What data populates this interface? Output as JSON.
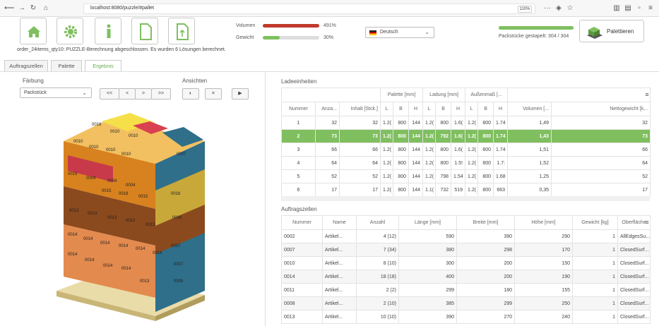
{
  "browser": {
    "url": "localhost:8080/puzzle/#pallet",
    "zoom": "110%"
  },
  "toolbar": {
    "volume_label": "Volumen",
    "volume_pct": "491%",
    "volume_fill": 1.0,
    "weight_label": "Gewicht",
    "weight_pct": "30%",
    "weight_fill": 0.3,
    "language": "Deutsch",
    "packed_text": "Packstücke gestapelt: 304 / 304",
    "packed_fill": 1.0,
    "palletize_label": "Palettieren"
  },
  "status_line": "order_24items_qty10:  PUZZLE-Berechnung abgeschlossen. Es wurden 6 Lösungen berechnet.",
  "tabs": [
    "Auftragszellen",
    "Palette",
    "Ergebnis"
  ],
  "left": {
    "coloring_label": "Färbung",
    "coloring_value": "Packstück",
    "views_label": "Ansichten",
    "nav_buttons": [
      "<<",
      "<",
      ">",
      ">>"
    ]
  },
  "load_units": {
    "title": "Ladeeinheiten",
    "group_headers": [
      "Palette [mm]",
      "Ladung [mm]",
      "Außenmaß [..."
    ],
    "headers": [
      "Nummer",
      "Anza...",
      "Inhalt [Stck.]",
      "L",
      "B",
      "H",
      "L",
      "B",
      "H",
      "L",
      "B",
      "H",
      "Volumen [...",
      "Nettogewicht [k..."
    ],
    "rows": [
      [
        "1",
        "32",
        "32",
        "1.2(",
        "800",
        "144",
        "1.2(",
        "800",
        "1.6(",
        "1.2(",
        "800",
        "1.74",
        "1,49",
        "32"
      ],
      [
        "2",
        "73",
        "73",
        "1.2(",
        "800",
        "144",
        "1.2(",
        "792",
        "1.6(",
        "1.2(",
        "800",
        "1.74",
        "1,43",
        "73"
      ],
      [
        "3",
        "66",
        "66",
        "1.2(",
        "800",
        "144",
        "1.2(",
        "800",
        "1.6(",
        "1.2(",
        "800",
        "1.74",
        "1,51",
        "66"
      ],
      [
        "4",
        "64",
        "64",
        "1.2(",
        "800",
        "144",
        "1.2(",
        "800",
        "1.5!",
        "1.2(",
        "800",
        "1.7:",
        "1,52",
        "64"
      ],
      [
        "5",
        "52",
        "52",
        "1.2(",
        "800",
        "144",
        "1.2(",
        "798",
        "1.54",
        "1.2(",
        "800",
        "1.68",
        "1,25",
        "52"
      ],
      [
        "6",
        "17",
        "17",
        "1.2(",
        "800",
        "144",
        "1.1(",
        "732",
        "519",
        "1.2(",
        "800",
        "663",
        "0,35",
        "17"
      ]
    ]
  },
  "order_cells": {
    "title": "Auftragszellen",
    "headers": [
      "Nummer",
      "Name",
      "Anzahl",
      "Länge [mm]",
      "Breite [mm]",
      "Höhe [mm]",
      "Gewicht [kg]",
      "Oberfläche"
    ],
    "rows": [
      [
        "0002",
        "Artikel...",
        "4 (12)",
        "590",
        "390",
        "290",
        "1",
        "AllEdgesSu..."
      ],
      [
        "0007",
        "Artikel...",
        "7 (34)",
        "380",
        "298",
        "170",
        "1",
        "ClosedSurf..."
      ],
      [
        "0010",
        "Artikel...",
        "8 (10)",
        "300",
        "200",
        "150",
        "1",
        "ClosedSurf..."
      ],
      [
        "0014",
        "Artikel...",
        "18 (18)",
        "400",
        "200",
        "190",
        "1",
        "ClosedSurf..."
      ],
      [
        "0011",
        "Artikel...",
        "2 (2)",
        "299",
        "180",
        "155",
        "1",
        "ClosedSurf..."
      ],
      [
        "0008",
        "Artikel...",
        "2 (10)",
        "385",
        "299",
        "250",
        "1",
        "ClosedSurf..."
      ],
      [
        "0013",
        "Artikel...",
        "10 (10)",
        "390",
        "270",
        "240",
        "1",
        "ClosedSurf..."
      ]
    ]
  },
  "pallet_labels": [
    "0016",
    "0010",
    "0010",
    "0010",
    "0010",
    "0010",
    "0010",
    "0007",
    "0015",
    "0004",
    "0004",
    "0004",
    "0015",
    "0018",
    "0015",
    "0016",
    "0013",
    "0013",
    "0013",
    "0012",
    "0013",
    "0016",
    "0014",
    "0014",
    "0014",
    "0014",
    "0014",
    "0014",
    "0014",
    "0014",
    "0014",
    "0014",
    "0007",
    "0007",
    "0013",
    "0005"
  ],
  "colors": {
    "accent": "#6aab4f",
    "selected_row": "#7fbf5f",
    "volume_bar": "#c0392b",
    "weight_bar": "#7fbf5f"
  }
}
